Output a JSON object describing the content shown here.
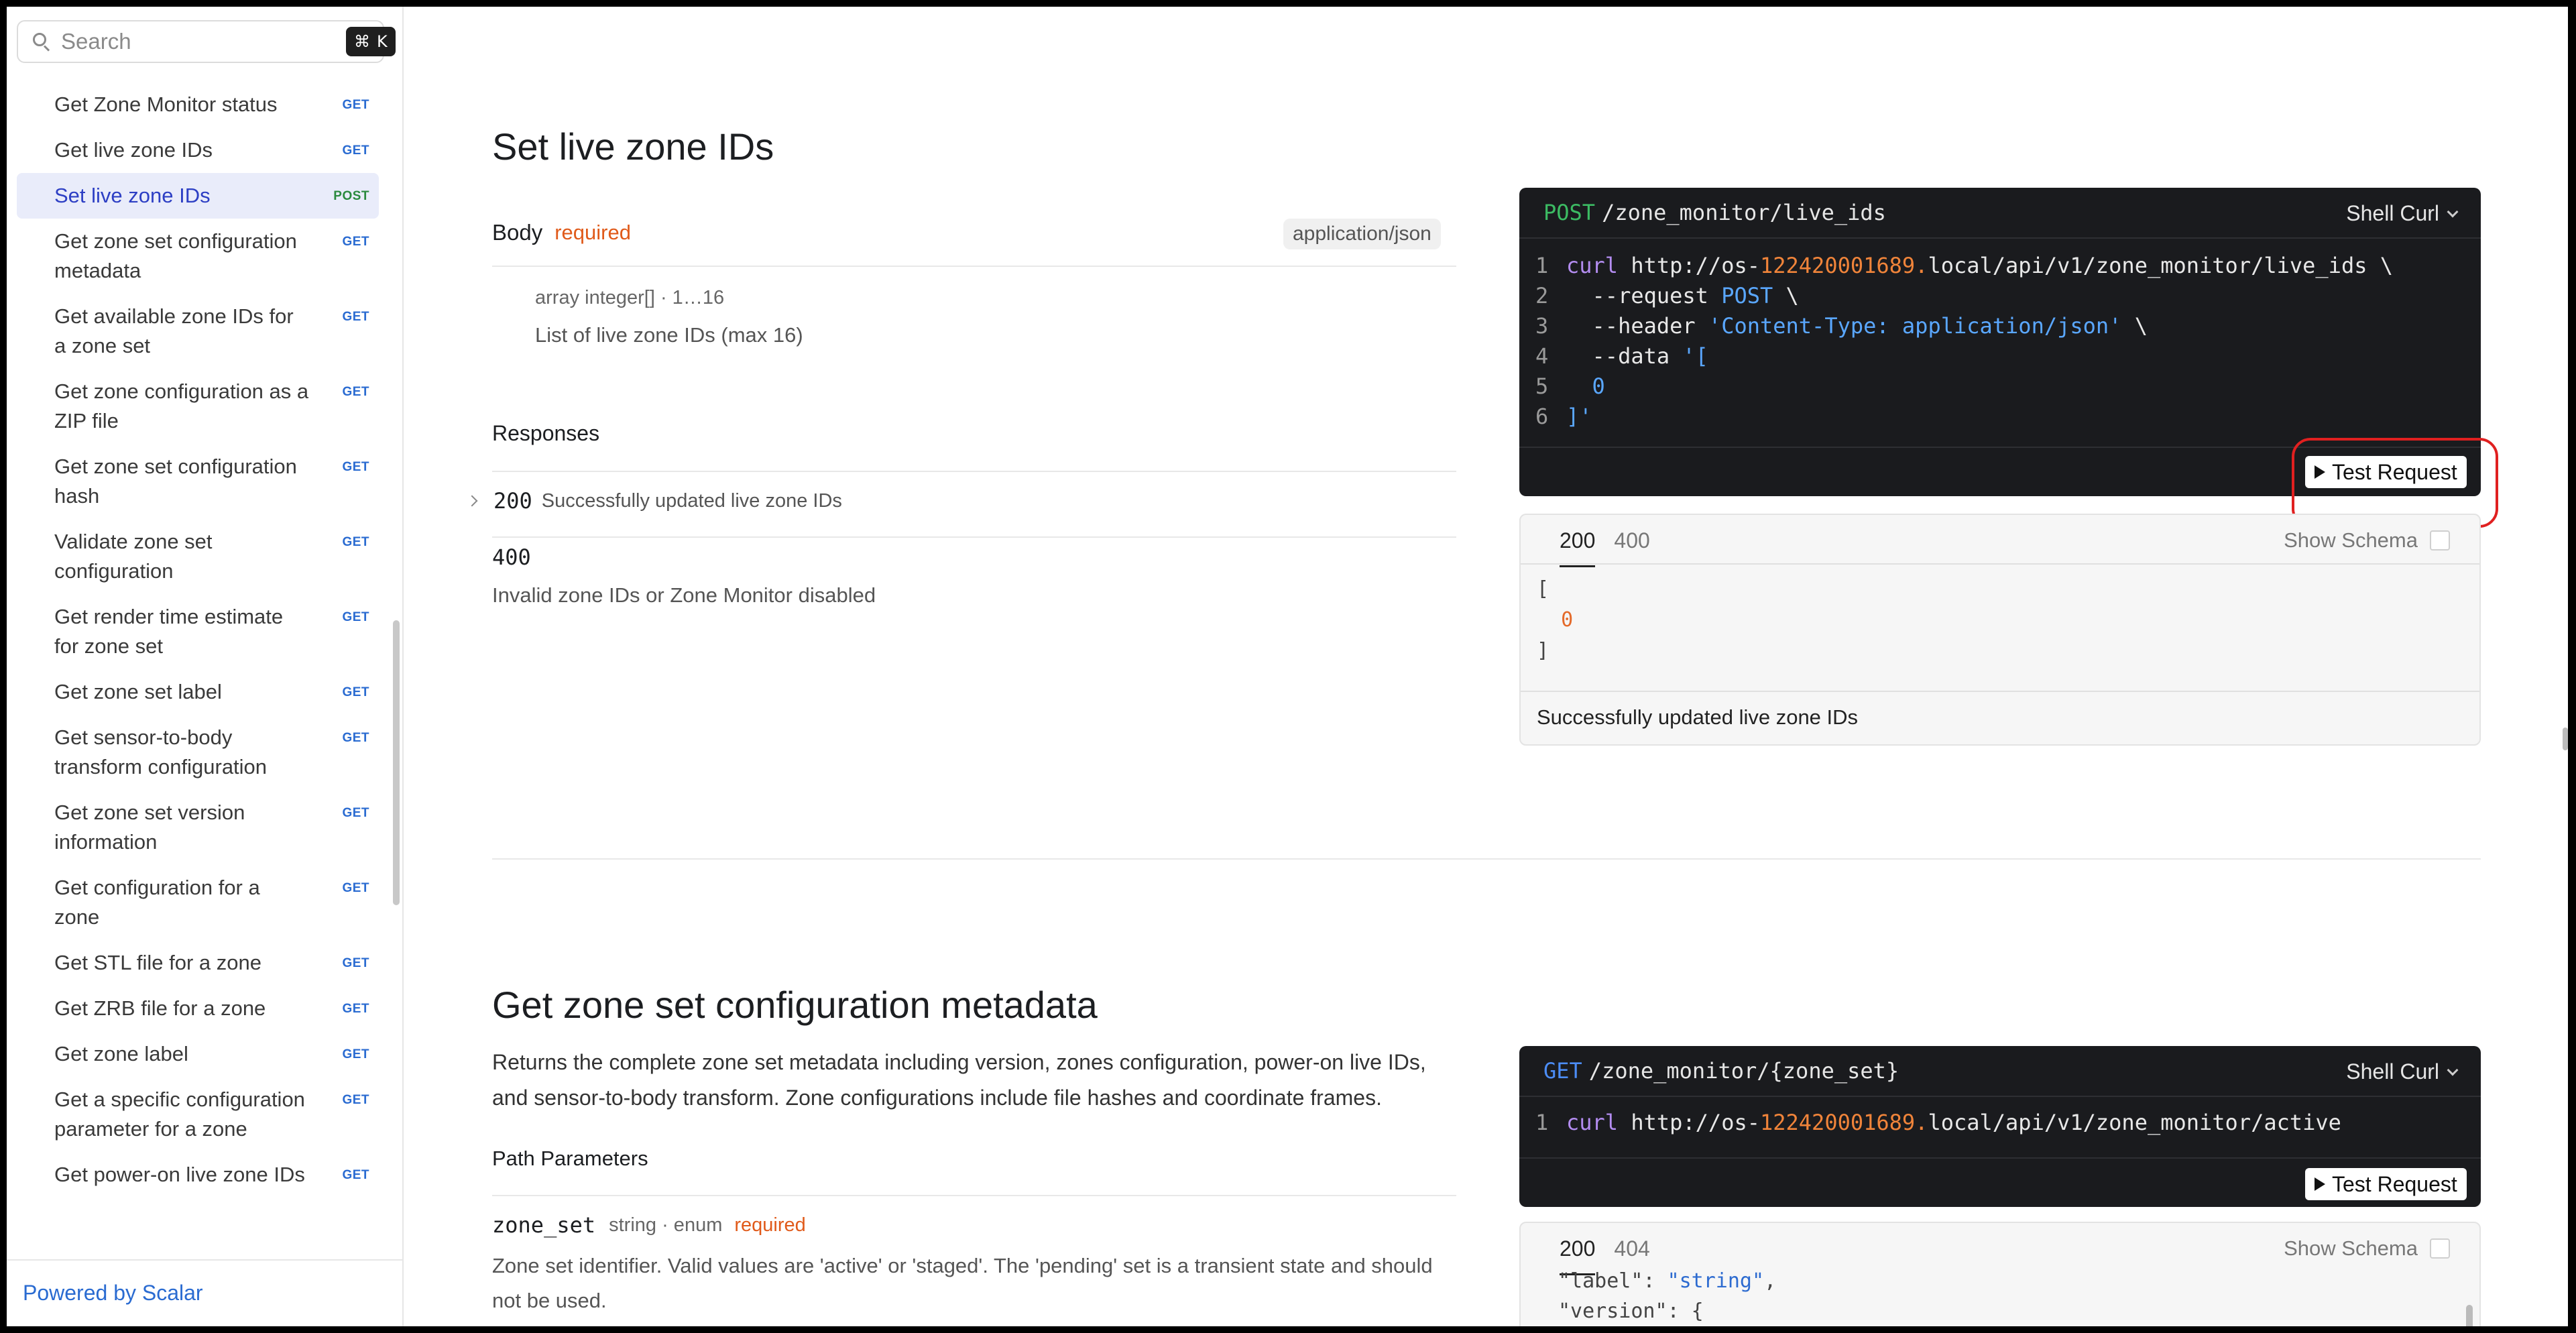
{
  "sidebar": {
    "search_placeholder": "Search",
    "shortcut_symbol": "⌘",
    "shortcut_key": "K",
    "items": [
      {
        "label": "Get Zone Monitor status",
        "method": "GET"
      },
      {
        "label": "Get live zone IDs",
        "method": "GET"
      },
      {
        "label": "Set live zone IDs",
        "method": "POST",
        "active": true
      },
      {
        "label": "Get zone set configuration metadata",
        "method": "GET"
      },
      {
        "label": "Get available zone IDs for a zone set",
        "method": "GET"
      },
      {
        "label": "Get zone configuration as a ZIP file",
        "method": "GET"
      },
      {
        "label": "Get zone set configuration hash",
        "method": "GET"
      },
      {
        "label": "Validate zone set configuration",
        "method": "GET"
      },
      {
        "label": "Get render time estimate for zone set",
        "method": "GET"
      },
      {
        "label": "Get zone set label",
        "method": "GET"
      },
      {
        "label": "Get sensor-to-body transform configuration",
        "method": "GET"
      },
      {
        "label": "Get zone set version information",
        "method": "GET"
      },
      {
        "label": "Get configuration for a zone",
        "method": "GET"
      },
      {
        "label": "Get STL file for a zone",
        "method": "GET"
      },
      {
        "label": "Get ZRB file for a zone",
        "method": "GET"
      },
      {
        "label": "Get zone label",
        "method": "GET"
      },
      {
        "label": "Get a specific configuration parameter for a zone",
        "method": "GET"
      },
      {
        "label": "Get power-on live zone IDs",
        "method": "GET"
      }
    ],
    "footer": "Powered by Scalar"
  },
  "section1": {
    "title": "Set live zone IDs",
    "body_label": "Body",
    "required": "required",
    "content_type": "application/json",
    "param_type": "array integer[] · 1…16",
    "param_desc": "List of live zone IDs (max 16)",
    "responses_label": "Responses",
    "responses": [
      {
        "code": "200",
        "desc": "Successfully updated live zone IDs"
      },
      {
        "code": "400",
        "desc": "Invalid zone IDs or Zone Monitor disabled"
      }
    ],
    "request": {
      "method": "POST",
      "path": "/zone_monitor/live_ids",
      "lang": "Shell Curl",
      "lines": [
        {
          "n": "1",
          "parts": [
            [
              "kw",
              "curl"
            ],
            [
              "plain",
              " http://os-"
            ],
            [
              "num",
              "122420001689."
            ],
            [
              "plain",
              "local/api/v1/zone_monitor/live_ids \\"
            ]
          ]
        },
        {
          "n": "2",
          "parts": [
            [
              "plain",
              "  --request "
            ],
            [
              "str",
              "POST"
            ],
            [
              "plain",
              " \\"
            ]
          ]
        },
        {
          "n": "3",
          "parts": [
            [
              "plain",
              "  --header "
            ],
            [
              "str",
              "'Content-Type: application/json'"
            ],
            [
              "plain",
              " \\"
            ]
          ]
        },
        {
          "n": "4",
          "parts": [
            [
              "plain",
              "  --data "
            ],
            [
              "str",
              "'["
            ]
          ]
        },
        {
          "n": "5",
          "parts": [
            [
              "str",
              "  0"
            ]
          ]
        },
        {
          "n": "6",
          "parts": [
            [
              "str",
              "]'"
            ]
          ]
        }
      ],
      "test_label": "Test Request"
    },
    "response_panel": {
      "tabs": [
        "200",
        "400"
      ],
      "schema_label": "Show Schema",
      "body_open": "[",
      "body_value": "0",
      "body_close": "]",
      "description": "Successfully updated live zone IDs"
    }
  },
  "section2": {
    "title": "Get zone set configuration metadata",
    "description": "Returns the complete zone set metadata including version, zones configuration, power-on live IDs, and sensor-to-body transform. Zone configurations include file hashes and coordinate frames.",
    "path_params_label": "Path Parameters",
    "param_name": "zone_set",
    "param_type": "string · enum",
    "required": "required",
    "param_desc": "Zone set identifier. Valid values are 'active' or 'staged'. The 'pending' set is a transient state and should not be used.",
    "request": {
      "method": "GET",
      "path": "/zone_monitor/{zone_set}",
      "lang": "Shell Curl",
      "line_n": "1",
      "line_kw": "curl",
      "line_pre": " http://os-",
      "line_num": "122420001689.",
      "line_post": "local/api/v1/zone_monitor/active",
      "test_label": "Test Request"
    },
    "response_panel": {
      "tabs": [
        "200",
        "404"
      ],
      "schema_label": "Show Schema",
      "line1_key": "\"label\"",
      "line1_val": "\"string\"",
      "line2_key": "\"version\"",
      "line2_rest": ": {"
    }
  }
}
